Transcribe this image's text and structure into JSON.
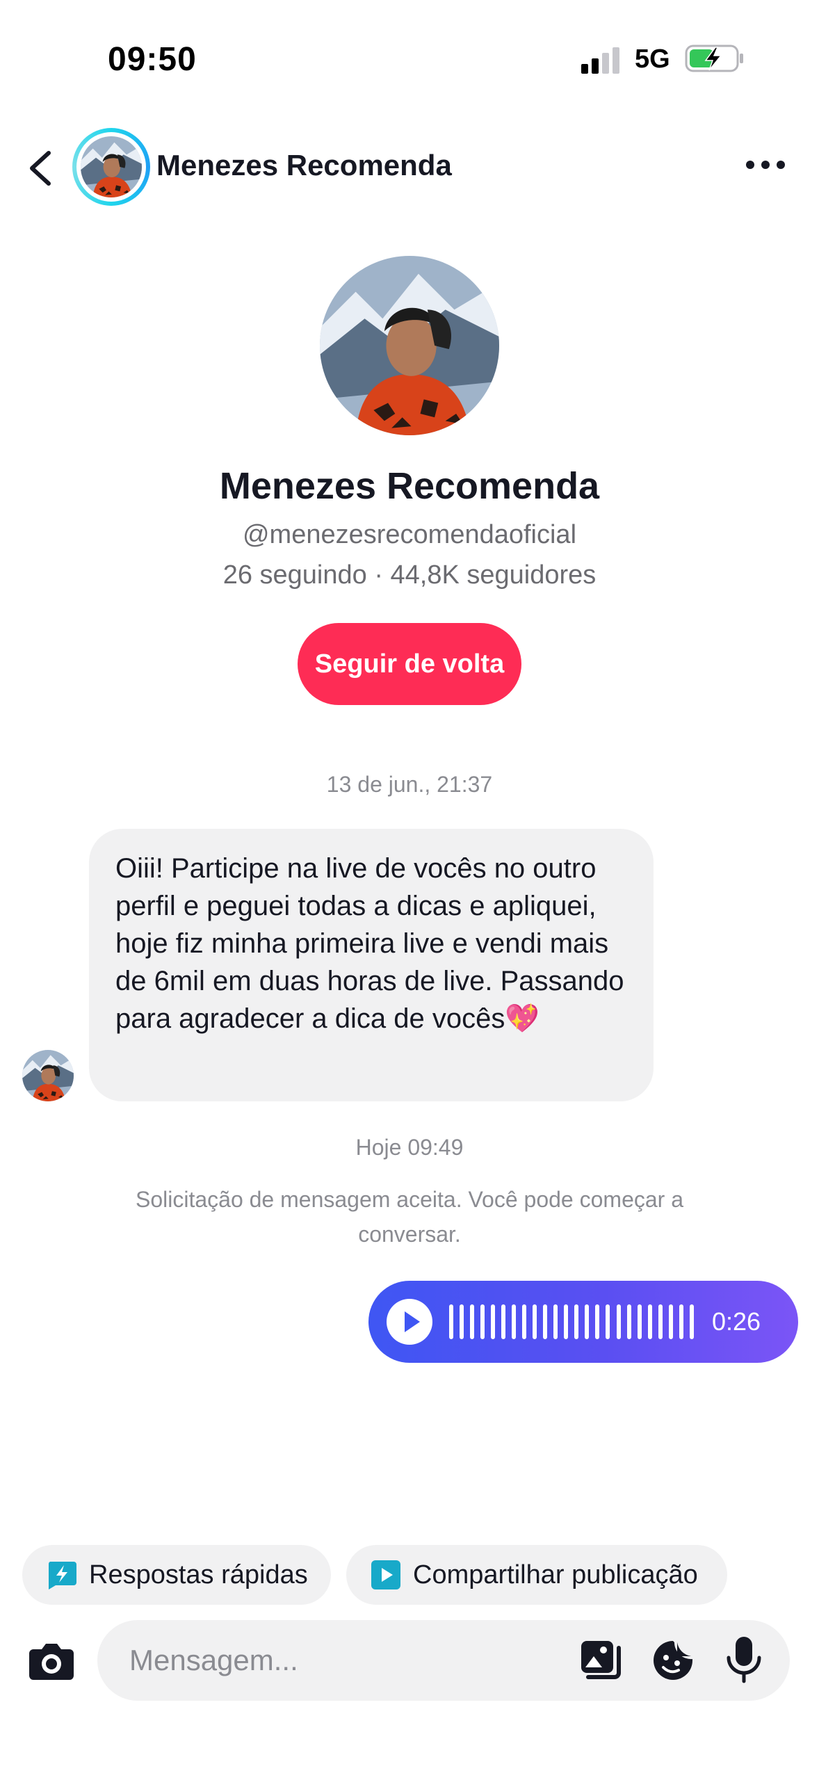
{
  "status_bar": {
    "time": "09:50",
    "network": "5G",
    "battery_state": "charging"
  },
  "header": {
    "name": "Menezes Recomenda",
    "icons": {
      "back": "chevron-left-icon",
      "more": "more-horizontal-icon"
    }
  },
  "profile": {
    "name": "Menezes Recomenda",
    "handle": "@menezesrecomendaoficial",
    "stats": "26 seguindo · 44,8K seguidores",
    "follow_button": "Seguir de volta"
  },
  "conversation": {
    "timestamp_1": "13 de jun., 21:37",
    "incoming_message": "Oiii! Participe na live de vocês no outro perfil e peguei todas a dicas e apliquei, hoje fiz minha primeira live e vendi mais de 6mil em duas horas de live. Passando para agradecer a dica de vocês💖",
    "timestamp_2": "Hoje 09:49",
    "system_message": "Solicitação de mensagem aceita. Você pode começar a conversar.",
    "audio_message": {
      "duration": "0:26"
    }
  },
  "quick_actions": {
    "quick_replies": "Respostas rápidas",
    "share_post": "Compartilhar publicação"
  },
  "composer": {
    "placeholder": "Mensagem...",
    "icons": [
      "camera-icon",
      "gallery-icon",
      "sticker-icon",
      "microphone-icon"
    ]
  },
  "colors": {
    "follow_button": "#fe2c55",
    "audio_gradient_start": "#3f56f3",
    "audio_gradient_end": "#7b55f6",
    "chip_icon": "#18a9c9",
    "battery_green": "#34c759"
  }
}
